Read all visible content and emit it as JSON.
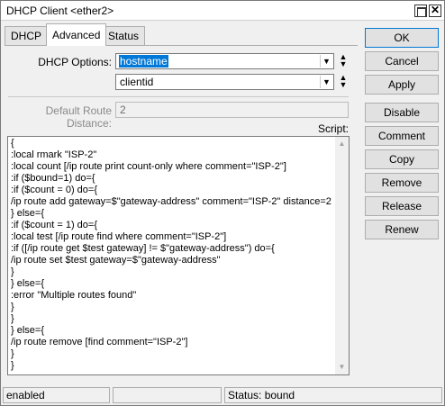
{
  "window": {
    "title": "DHCP Client <ether2>",
    "restore_icon": "restore-icon",
    "close_icon": "close-icon",
    "close_glyph": "✕"
  },
  "tabs": [
    {
      "label": "DHCP"
    },
    {
      "label": "Advanced",
      "active": true
    },
    {
      "label": "Status"
    }
  ],
  "form": {
    "dhcp_options_label": "DHCP Options:",
    "dhcp_options": [
      "hostname",
      "clientid"
    ],
    "default_route_distance_label": "Default Route Distance:",
    "default_route_distance_value": "2",
    "script_label": "Script:"
  },
  "script": "{\n:local rmark \"ISP-2\"\n:local count [/ip route print count-only where comment=\"ISP-2\"]\n:if ($bound=1) do={\n:if ($count = 0) do={\n/ip route add gateway=$\"gateway-address\" comment=\"ISP-2\" distance=2\n} else={\n:if ($count = 1) do={\n:local test [/ip route find where comment=\"ISP-2\"]\n:if ([/ip route get $test gateway] != $\"gateway-address\") do={\n/ip route set $test gateway=$\"gateway-address\"\n}\n} else={\n:error \"Multiple routes found\"\n}\n}\n} else={\n/ip route remove [find comment=\"ISP-2\"]\n}\n}",
  "buttons": {
    "ok": "OK",
    "cancel": "Cancel",
    "apply": "Apply",
    "disable": "Disable",
    "comment": "Comment",
    "copy": "Copy",
    "remove": "Remove",
    "release": "Release",
    "renew": "Renew"
  },
  "status": {
    "state": "enabled",
    "middle": "",
    "bound": "Status: bound"
  },
  "colors": {
    "selection": "#0078d7",
    "primary_border": "#0078d7"
  }
}
